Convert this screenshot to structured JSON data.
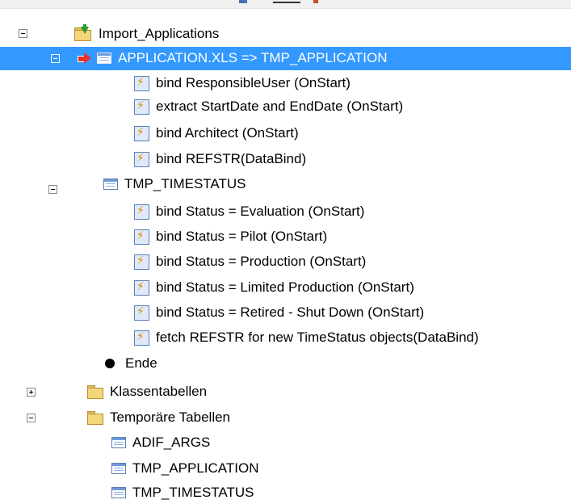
{
  "tree": {
    "root": {
      "label": "Import_Applications",
      "icon": "folder-import-icon"
    },
    "application_step": {
      "label": "APPLICATION.XLS => TMP_APPLICATION",
      "selected": true,
      "icon": "table-icon"
    },
    "application_children": [
      {
        "label": "bind ResponsibleUser (OnStart)",
        "icon": "event-bolt-icon"
      },
      {
        "label": "extract StartDate and EndDate (OnStart)",
        "icon": "event-bolt-icon"
      },
      {
        "label": "bind Architect (OnStart)",
        "icon": "event-bolt-icon"
      },
      {
        "label": "bind REFSTR(DataBind)",
        "icon": "event-bolt-icon"
      }
    ],
    "timestatus_step": {
      "label": "TMP_TIMESTATUS",
      "icon": "table-icon"
    },
    "timestatus_children": [
      {
        "label": "bind Status = Evaluation (OnStart)",
        "icon": "event-bolt-icon"
      },
      {
        "label": "bind Status = Pilot (OnStart)",
        "icon": "event-bolt-icon"
      },
      {
        "label": "bind Status = Production (OnStart)",
        "icon": "event-bolt-icon"
      },
      {
        "label": "bind Status = Limited Production (OnStart)",
        "icon": "event-bolt-icon"
      },
      {
        "label": "bind Status = Retired - Shut Down (OnStart)",
        "icon": "event-bolt-icon"
      },
      {
        "label": "fetch REFSTR for new TimeStatus objects(DataBind)",
        "icon": "event-bolt-icon"
      }
    ],
    "end": {
      "label": "Ende",
      "icon": "end-dot-icon"
    },
    "class_tables": {
      "label": "Klassentabellen",
      "expanded": false,
      "icon": "folder-icon"
    },
    "temp_tables": {
      "label": "Temporäre Tabellen",
      "expanded": true,
      "icon": "folder-icon"
    },
    "temp_children": [
      {
        "label": "ADIF_ARGS",
        "icon": "table-icon"
      },
      {
        "label": "TMP_APPLICATION",
        "icon": "table-icon"
      },
      {
        "label": "TMP_TIMESTATUS",
        "icon": "table-icon"
      }
    ]
  },
  "colors": {
    "selection": "#3399ff",
    "selection_text": "#ffffff",
    "arrow": "#e83030"
  }
}
